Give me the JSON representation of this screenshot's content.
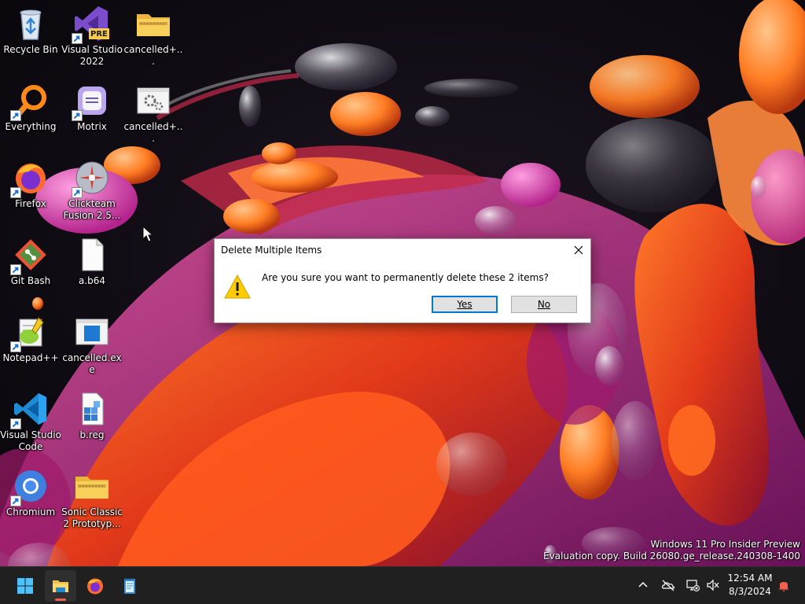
{
  "desktop": {
    "icons": [
      {
        "label": "Recycle Bin",
        "icon": "recycle-bin-icon"
      },
      {
        "label": "Visual Studio 2022 Preview",
        "icon": "visual-studio-preview-icon",
        "badge": "PRE"
      },
      {
        "label": "cancelled+...",
        "icon": "zip-folder-icon"
      },
      {
        "label": "Everything",
        "icon": "everything-search-icon"
      },
      {
        "label": "Motrix",
        "icon": "motrix-icon"
      },
      {
        "label": "cancelled+...",
        "icon": "settings-file-icon"
      },
      {
        "label": "Firefox",
        "icon": "firefox-icon"
      },
      {
        "label": "Clickteam Fusion 2.5...",
        "icon": "clickteam-fusion-icon"
      },
      {
        "label": "Git Bash",
        "icon": "git-bash-icon"
      },
      {
        "label": "a.b64",
        "icon": "blank-file-icon"
      },
      {
        "label": "Notepad++",
        "icon": "notepad-plus-plus-icon"
      },
      {
        "label": "cancelled.exe",
        "icon": "exe-window-icon"
      },
      {
        "label": "Visual Studio Code",
        "icon": "vscode-icon"
      },
      {
        "label": "b.reg",
        "icon": "registry-file-icon"
      },
      {
        "label": "Chromium",
        "icon": "chromium-icon"
      },
      {
        "label": "Sonic Classic 2 Prototyp...",
        "icon": "zip-folder-icon"
      }
    ]
  },
  "dialog": {
    "title": "Delete Multiple Items",
    "message": "Are you sure you want to permanently delete these 2 items?",
    "yes_label": "Yes",
    "no_label": "No",
    "icon": "warning-icon"
  },
  "watermark": {
    "line1": "Windows 11 Pro Insider Preview",
    "line2": "Evaluation copy. Build 26080.ge_release.240308-1400"
  },
  "taskbar": {
    "apps": [
      "start-icon",
      "file-explorer-icon",
      "firefox-icon",
      "notepad-icon"
    ],
    "tray_icons": [
      "chevron-up-icon",
      "onedrive-offline-icon",
      "network-disconnected-icon",
      "volume-muted-icon",
      "notification-bell-icon"
    ],
    "time": "12:54 AM",
    "date": "8/3/2024"
  },
  "colors": {
    "accent": "#0078d4",
    "taskbar": "#202020",
    "warning": "#ffcc00",
    "notification": "#f4604e"
  }
}
